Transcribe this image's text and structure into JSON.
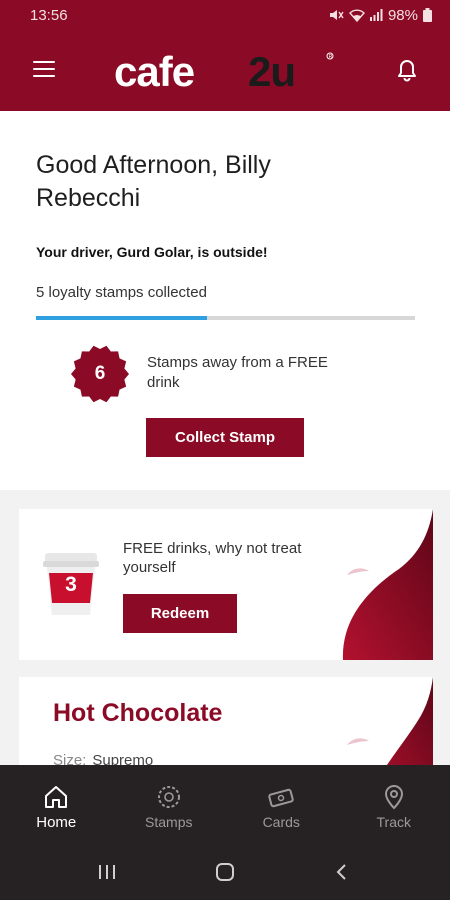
{
  "status_bar": {
    "time": "13:56",
    "battery": "98%",
    "icons": [
      "mute-icon",
      "wifi-icon",
      "signal-icon",
      "battery-icon"
    ]
  },
  "header": {
    "logo_text": "cafe2u",
    "icons": [
      "menu-icon",
      "bell-icon"
    ]
  },
  "welcome": {
    "greeting": "Good Afternoon, Billy Rebecchi",
    "driver_message": "Your driver, Gurd Golar, is outside!",
    "stamps_collected": "5 loyalty stamps collected",
    "progress_fraction": 0.45,
    "stamps_away_count": "6",
    "stamps_away_text": "Stamps away from a FREE drink",
    "collect_button": "Collect Stamp"
  },
  "redeem_card": {
    "count": "3",
    "text": "FREE drinks, why not treat yourself",
    "button": "Redeem"
  },
  "order_card": {
    "title": "Hot Chocolate",
    "size_label": "Size:",
    "size_value": "Supremo"
  },
  "bottom_nav": {
    "items": [
      {
        "label": "Home",
        "icon": "home-icon",
        "active": true
      },
      {
        "label": "Stamps",
        "icon": "stamp-icon",
        "active": false
      },
      {
        "label": "Cards",
        "icon": "cards-icon",
        "active": false
      },
      {
        "label": "Track",
        "icon": "location-icon",
        "active": false
      }
    ]
  },
  "system_nav": {
    "buttons": [
      "recents-button",
      "home-button",
      "back-button"
    ]
  },
  "colors": {
    "brand": "#8b0a25",
    "progress": "#2f9fe0",
    "nav_background": "#262223"
  }
}
